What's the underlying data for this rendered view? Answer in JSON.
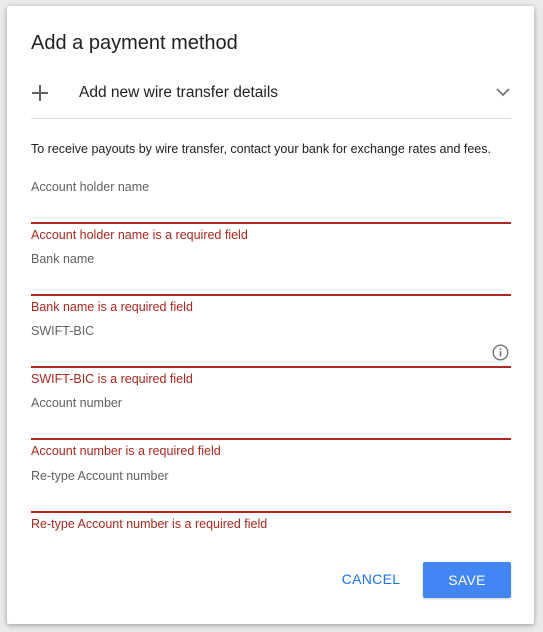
{
  "dialog": {
    "title": "Add a payment method",
    "method": {
      "label": "Add new wire transfer details",
      "expand_icon": "plus-icon",
      "dropdown_icon": "chevron-down-icon"
    },
    "info_text": "To receive payouts by wire transfer, contact your bank for exchange rates and fees.",
    "fields": [
      {
        "label": "Account holder name",
        "value": "",
        "error": "Account holder name is a required field"
      },
      {
        "label": "Bank name",
        "value": "",
        "error": "Bank name is a required field"
      },
      {
        "label": "SWIFT-BIC",
        "value": "",
        "error": "SWIFT-BIC is a required field",
        "icon": "info-icon"
      },
      {
        "label": "Account number",
        "value": "",
        "error": "Account number is a required field"
      },
      {
        "label": "Re-type Account number",
        "value": "",
        "error": "Re-type Account number is a required field"
      }
    ],
    "actions": {
      "cancel_label": "CANCEL",
      "save_label": "SAVE"
    },
    "colors": {
      "accent": "#4285f4",
      "link": "#1a73e8",
      "error": "#a8291f"
    }
  }
}
